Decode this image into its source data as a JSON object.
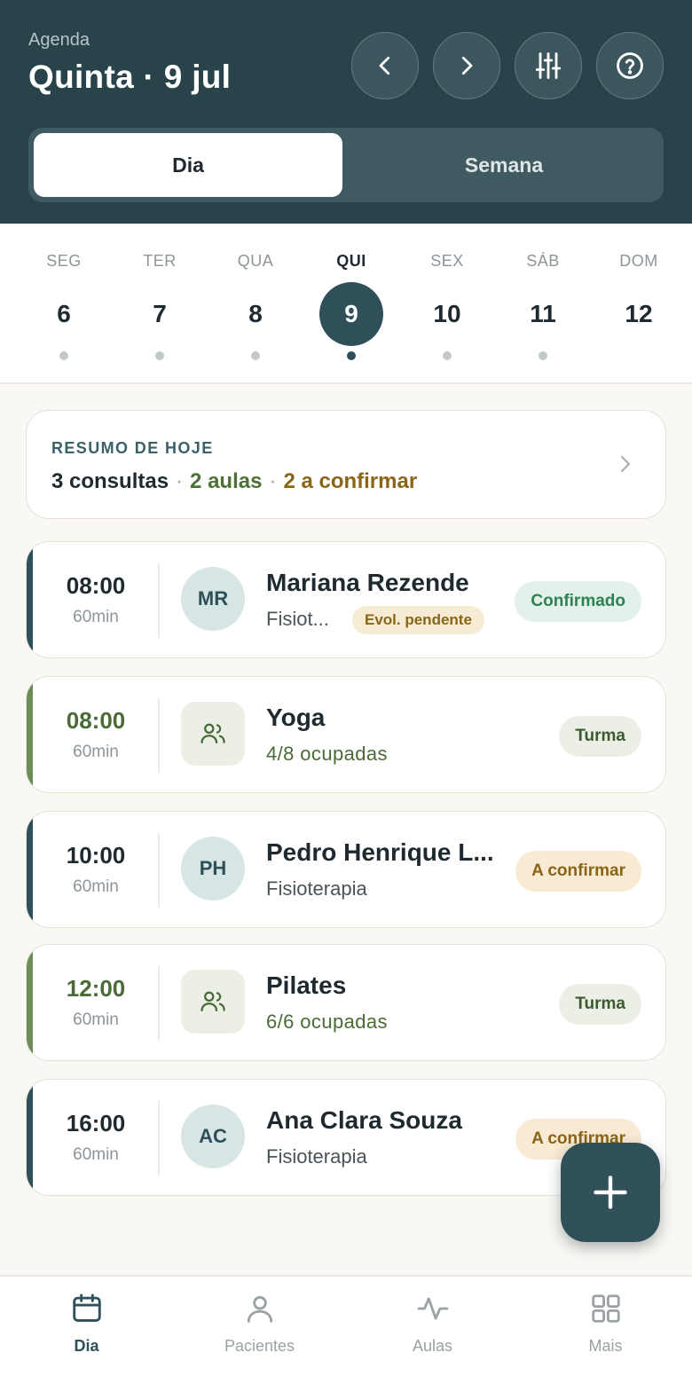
{
  "header": {
    "section_label": "Agenda",
    "date_title": "Quinta · 9 jul",
    "buttons": [
      {
        "icon": "chevron-left-icon"
      },
      {
        "icon": "chevron-right-icon"
      },
      {
        "icon": "sliders-icon"
      },
      {
        "icon": "help-icon"
      }
    ]
  },
  "view_toggle": {
    "day_label": "Dia",
    "week_label": "Semana",
    "selected": "Dia"
  },
  "week": [
    {
      "name": "SEG",
      "num": "6"
    },
    {
      "name": "TER",
      "num": "7"
    },
    {
      "name": "QUA",
      "num": "8"
    },
    {
      "name": "QUI",
      "num": "9",
      "selected": true
    },
    {
      "name": "SEX",
      "num": "10"
    },
    {
      "name": "SÁB",
      "num": "11"
    },
    {
      "name": "DOM",
      "num": "12"
    }
  ],
  "summary": {
    "label": "RESUMO DE HOJE",
    "consultas": "3 consultas",
    "aulas": "2 aulas",
    "a_confirmar": "2 a confirmar",
    "separator": "·"
  },
  "appointments": [
    {
      "type": "appointment",
      "time": "08:00",
      "duration": "60min",
      "initials": "MR",
      "name": "Mariana Rezende",
      "detail": "Fisiot...",
      "tag": "Evol. pendente",
      "status": "Confirmado"
    },
    {
      "type": "class",
      "time": "08:00",
      "duration": "60min",
      "name": "Yoga",
      "detail": "4/8 ocupadas",
      "status": "Turma"
    },
    {
      "type": "appointment",
      "time": "10:00",
      "duration": "60min",
      "initials": "PH",
      "name": "Pedro Henrique L...",
      "detail": "Fisioterapia",
      "status": "A confirmar"
    },
    {
      "type": "class",
      "time": "12:00",
      "duration": "60min",
      "name": "Pilates",
      "detail": "6/6 ocupadas",
      "status": "Turma"
    },
    {
      "type": "appointment",
      "time": "16:00",
      "duration": "60min",
      "initials": "AC",
      "name": "Ana Clara Souza",
      "detail": "Fisioterapia",
      "status": "A confirmar"
    }
  ],
  "fab": {
    "icon": "plus-icon"
  },
  "nav": [
    {
      "label": "Dia",
      "icon": "calendar-icon",
      "active": true
    },
    {
      "label": "Pacientes",
      "icon": "person-icon"
    },
    {
      "label": "Aulas",
      "icon": "activity-icon"
    },
    {
      "label": "Mais",
      "icon": "grid-icon"
    }
  ],
  "colors": {
    "header_bg": "#28434a",
    "primary": "#2f5059",
    "class_accent": "#6e8c57",
    "confirmed": "#2e8153",
    "pending": "#8a6517"
  }
}
